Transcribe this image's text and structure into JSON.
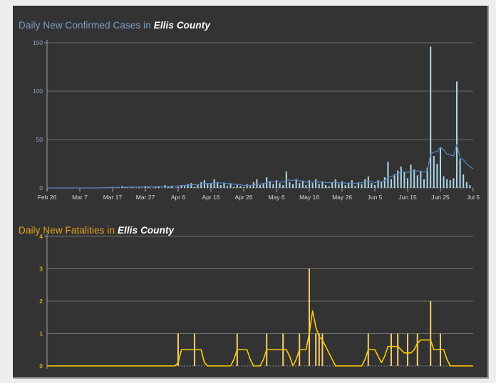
{
  "page": {
    "background": "#ededed",
    "panel_background": "#333333",
    "border_color": "#9a9a9a"
  },
  "charts": [
    {
      "id": "cases",
      "title_prefix": "Daily New Confirmed Cases in ",
      "title_county": "Ellis County",
      "title_color": "#7f9fc4",
      "county_color": "#ffffff"
    },
    {
      "id": "deaths",
      "title_prefix": "Daily New Fatalities in ",
      "title_county": "Ellis County",
      "title_color": "#e8a317",
      "county_color": "#ffffff"
    }
  ],
  "chart_data": [
    {
      "type": "bar",
      "id": "daily-new-confirmed-cases",
      "title": "Daily New Confirmed Cases in Ellis County",
      "subtitle": "",
      "xlabel": "",
      "ylabel": "",
      "grid": true,
      "legend": "none",
      "bar_color": "#a9d5e8",
      "line_color": "#5785c0",
      "line_name": "7-day moving average",
      "axis_color": "#9a9a9a",
      "label_color": "#8ca5c6",
      "ylim": [
        0,
        150
      ],
      "yticks": [
        0,
        50,
        100,
        150
      ],
      "xlim": [
        "Feb 26",
        "Jul 5"
      ],
      "xticks": [
        "Feb 26",
        "Mar 7",
        "Mar 17",
        "Mar 27",
        "Apr 6",
        "Apr 16",
        "Apr 26",
        "May 6",
        "May 16",
        "May 26",
        "Jun 5",
        "Jun 15",
        "Jun 25",
        "Jul 5"
      ],
      "x_start_date": "Feb 26",
      "x_end_date": "Jul 5",
      "n_days": 131,
      "values": [
        0,
        0,
        0,
        0,
        0,
        0,
        0,
        0,
        0,
        0,
        0,
        0,
        0,
        0,
        0,
        0,
        0,
        0,
        0,
        0,
        1,
        0,
        0,
        2,
        1,
        0,
        1,
        0,
        1,
        0,
        2,
        1,
        0,
        1,
        2,
        0,
        3,
        1,
        2,
        0,
        1,
        3,
        2,
        4,
        5,
        1,
        3,
        6,
        8,
        4,
        5,
        9,
        6,
        3,
        5,
        2,
        4,
        1,
        3,
        2,
        1,
        4,
        2,
        6,
        9,
        3,
        5,
        11,
        7,
        4,
        8,
        5,
        3,
        17,
        6,
        4,
        9,
        5,
        7,
        3,
        8,
        5,
        9,
        4,
        7,
        3,
        2,
        6,
        9,
        4,
        7,
        3,
        5,
        8,
        2,
        6,
        4,
        9,
        12,
        5,
        3,
        8,
        6,
        11,
        27,
        9,
        14,
        18,
        22,
        16,
        10,
        24,
        19,
        13,
        17,
        9,
        21,
        146,
        33,
        25,
        41,
        12,
        9,
        8,
        10,
        110,
        30,
        14,
        6,
        3,
        0
      ],
      "moving_average": [
        0,
        0,
        0,
        0,
        0,
        0,
        0,
        0,
        0,
        0,
        0,
        0,
        0,
        0,
        0,
        0,
        0.1,
        0.2,
        0.3,
        0.4,
        0.5,
        0.5,
        0.6,
        0.7,
        0.8,
        0.8,
        0.9,
        0.9,
        1.0,
        1.0,
        1.1,
        1.1,
        1.2,
        1.2,
        1.3,
        1.3,
        1.6,
        1.7,
        1.9,
        1.9,
        2.0,
        2.4,
        2.6,
        3.0,
        3.4,
        3.3,
        3.4,
        3.9,
        4.6,
        4.7,
        4.6,
        5.3,
        5.4,
        5.1,
        5.2,
        4.4,
        4.5,
        3.7,
        3.6,
        3.4,
        2.6,
        3.0,
        2.6,
        3.0,
        3.9,
        3.9,
        4.3,
        5.7,
        6.1,
        6.4,
        7.0,
        6.1,
        6.0,
        8.1,
        8.0,
        7.7,
        8.7,
        7.1,
        7.3,
        5.9,
        6.0,
        5.9,
        6.6,
        5.9,
        6.2,
        5.6,
        5.4,
        5.7,
        5.9,
        5.0,
        5.7,
        4.9,
        5.1,
        5.4,
        4.6,
        5.3,
        5.3,
        5.9,
        6.6,
        6.4,
        5.3,
        6.7,
        6.1,
        7.6,
        11.0,
        11.7,
        13.1,
        14.6,
        16.7,
        16.7,
        16.0,
        17.7,
        17.6,
        17.6,
        17.3,
        16.3,
        17.6,
        35.0,
        37.0,
        37.7,
        42.1,
        39.5,
        35.0,
        34.0,
        33.1,
        45.0,
        31.4,
        29.0,
        25.0,
        22.0,
        20.0
      ]
    },
    {
      "type": "bar",
      "id": "daily-new-fatalities",
      "title": "Daily New Fatalities in Ellis County",
      "subtitle": "",
      "xlabel": "",
      "ylabel": "",
      "grid": true,
      "legend": "none",
      "bar_color": "#f5c96a",
      "line_color": "#ffcc00",
      "line_name": "7-day moving average",
      "axis_color": "#9a9a9a",
      "label_color": "#d9a21b",
      "ylim": [
        0,
        4
      ],
      "yticks": [
        0,
        1,
        2,
        3,
        4
      ],
      "xlim": [
        "Feb 26",
        "Jul 5"
      ],
      "x_start_date": "Feb 26",
      "x_end_date": "Jul 5",
      "n_days": 131,
      "values": [
        0,
        0,
        0,
        0,
        0,
        0,
        0,
        0,
        0,
        0,
        0,
        0,
        0,
        0,
        0,
        0,
        0,
        0,
        0,
        0,
        0,
        0,
        0,
        0,
        0,
        0,
        0,
        0,
        0,
        0,
        0,
        0,
        0,
        0,
        0,
        0,
        0,
        0,
        0,
        0,
        1,
        0,
        0,
        0,
        0,
        1,
        0,
        0,
        0,
        0,
        0,
        0,
        0,
        0,
        0,
        0,
        0,
        0,
        1,
        0,
        0,
        0,
        0,
        0,
        0,
        0,
        0,
        1,
        0,
        0,
        0,
        0,
        1,
        0,
        0,
        0,
        0,
        1,
        0,
        0,
        3,
        0,
        1,
        1,
        1,
        0,
        0,
        0,
        0,
        0,
        0,
        0,
        0,
        0,
        0,
        0,
        0,
        0,
        1,
        0,
        0,
        0,
        0,
        0,
        0,
        1,
        0,
        1,
        0,
        0,
        1,
        0,
        0,
        1,
        0,
        0,
        0,
        2,
        0,
        0,
        1,
        0,
        0,
        0,
        0,
        0,
        0,
        0,
        0,
        0,
        0
      ],
      "moving_average": [
        0,
        0,
        0,
        0,
        0,
        0,
        0,
        0,
        0,
        0,
        0,
        0,
        0,
        0,
        0,
        0,
        0,
        0,
        0,
        0,
        0,
        0,
        0,
        0,
        0,
        0,
        0,
        0,
        0,
        0,
        0,
        0,
        0,
        0,
        0,
        0,
        0,
        0,
        0,
        0,
        0.1,
        0.5,
        0.5,
        0.5,
        0.5,
        0.5,
        0.5,
        0.5,
        0.1,
        0,
        0,
        0,
        0,
        0,
        0,
        0,
        0,
        0.2,
        0.5,
        0.5,
        0.5,
        0.5,
        0.2,
        0,
        0,
        0,
        0.2,
        0.5,
        0.5,
        0.5,
        0.5,
        0.5,
        0.5,
        0.5,
        0.3,
        0,
        0.2,
        0.5,
        0.5,
        0.5,
        1.0,
        1.7,
        1.2,
        0.9,
        0.8,
        0.6,
        0.4,
        0.2,
        0,
        0,
        0,
        0,
        0,
        0,
        0,
        0,
        0,
        0.2,
        0.5,
        0.5,
        0.5,
        0.3,
        0.1,
        0.3,
        0.6,
        0.6,
        0.6,
        0.6,
        0.5,
        0.4,
        0.4,
        0.4,
        0.5,
        0.7,
        0.8,
        0.8,
        0.8,
        0.8,
        0.5,
        0.5,
        0.5,
        0.5,
        0.2,
        0,
        0,
        0,
        0,
        0,
        0,
        0,
        0
      ]
    }
  ]
}
